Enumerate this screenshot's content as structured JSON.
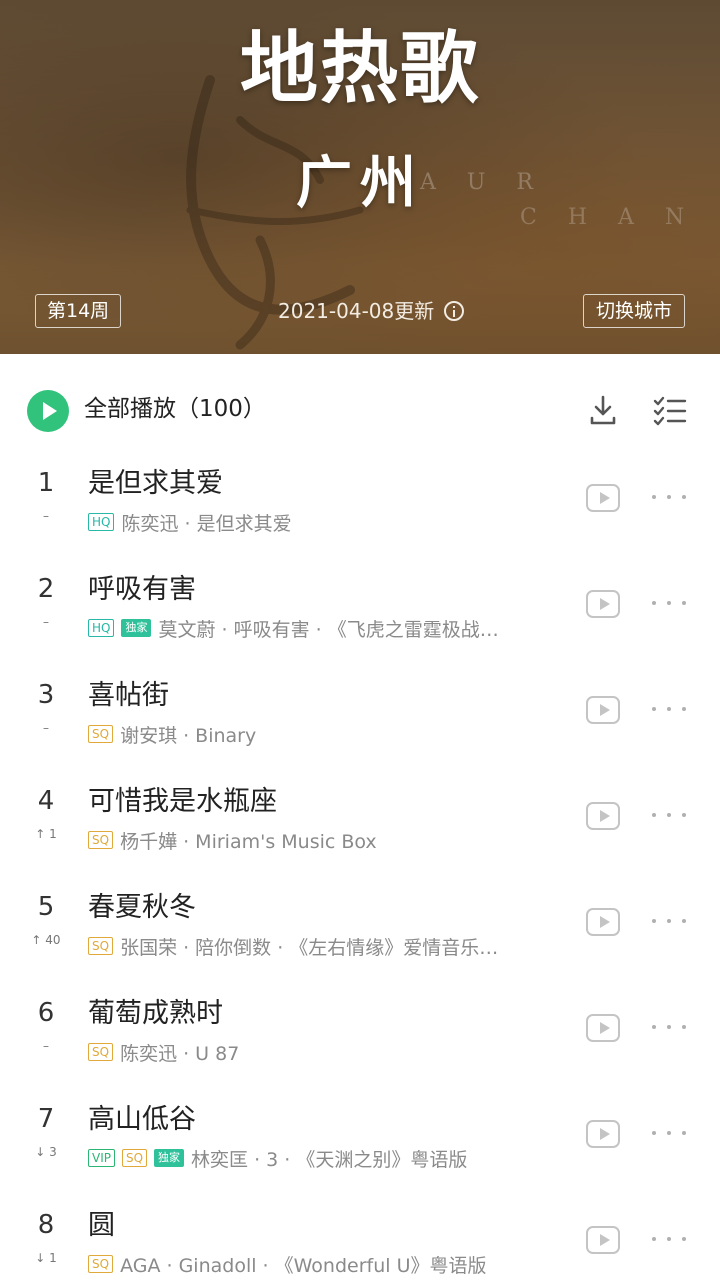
{
  "header": {
    "title": "地热歌",
    "city": "广州",
    "week_tag": "第14周",
    "update_text": "2021-04-08更新",
    "switch_city_label": "切换城市"
  },
  "toolbar": {
    "play_all_label": "全部播放（100）"
  },
  "icons": {
    "play_all": "play-circle-icon",
    "download": "download-icon",
    "multi_select": "multi-select-icon",
    "info": "info-icon",
    "mv": "play-video-icon",
    "more": "more-dots-icon"
  },
  "colors": {
    "accent": "#31c27c",
    "hq": "#28b8a6",
    "sq": "#e0a93a",
    "vip": "#2bb673"
  },
  "songs": [
    {
      "rank": "1",
      "trend": "–",
      "title": "是但求其爱",
      "badges": [
        {
          "type": "hq",
          "text": "HQ"
        }
      ],
      "meta": "陈奕迅 · 是但求其爱"
    },
    {
      "rank": "2",
      "trend": "–",
      "title": "呼吸有害",
      "badges": [
        {
          "type": "hq",
          "text": "HQ"
        },
        {
          "type": "excl",
          "text": "独家"
        }
      ],
      "meta": "莫文蔚 · 呼吸有害 · 《飞虎之雷霆极战…"
    },
    {
      "rank": "3",
      "trend": "–",
      "title": "喜帖街",
      "badges": [
        {
          "type": "sq",
          "text": "SQ"
        }
      ],
      "meta": "谢安琪 · Binary"
    },
    {
      "rank": "4",
      "trend": "↑ 1",
      "title": "可惜我是水瓶座",
      "badges": [
        {
          "type": "sq",
          "text": "SQ"
        }
      ],
      "meta": "杨千嬅 · Miriam's Music Box"
    },
    {
      "rank": "5",
      "trend": "↑ 40",
      "title": "春夏秋冬",
      "badges": [
        {
          "type": "sq",
          "text": "SQ"
        }
      ],
      "meta": "张国荣 · 陪你倒数 · 《左右情缘》爱情音乐…"
    },
    {
      "rank": "6",
      "trend": "–",
      "title": "葡萄成熟时",
      "badges": [
        {
          "type": "sq",
          "text": "SQ"
        }
      ],
      "meta": "陈奕迅 · U 87"
    },
    {
      "rank": "7",
      "trend": "↓ 3",
      "title": "高山低谷",
      "badges": [
        {
          "type": "vip",
          "text": "VIP"
        },
        {
          "type": "sq",
          "text": "SQ"
        },
        {
          "type": "excl",
          "text": "独家"
        }
      ],
      "meta": "林奕匡 · 3 · 《天渊之别》粤语版"
    },
    {
      "rank": "8",
      "trend": "↓ 1",
      "title": "圆",
      "badges": [
        {
          "type": "sq",
          "text": "SQ"
        }
      ],
      "meta": "AGA · Ginadoll · 《Wonderful U》粤语版"
    }
  ]
}
